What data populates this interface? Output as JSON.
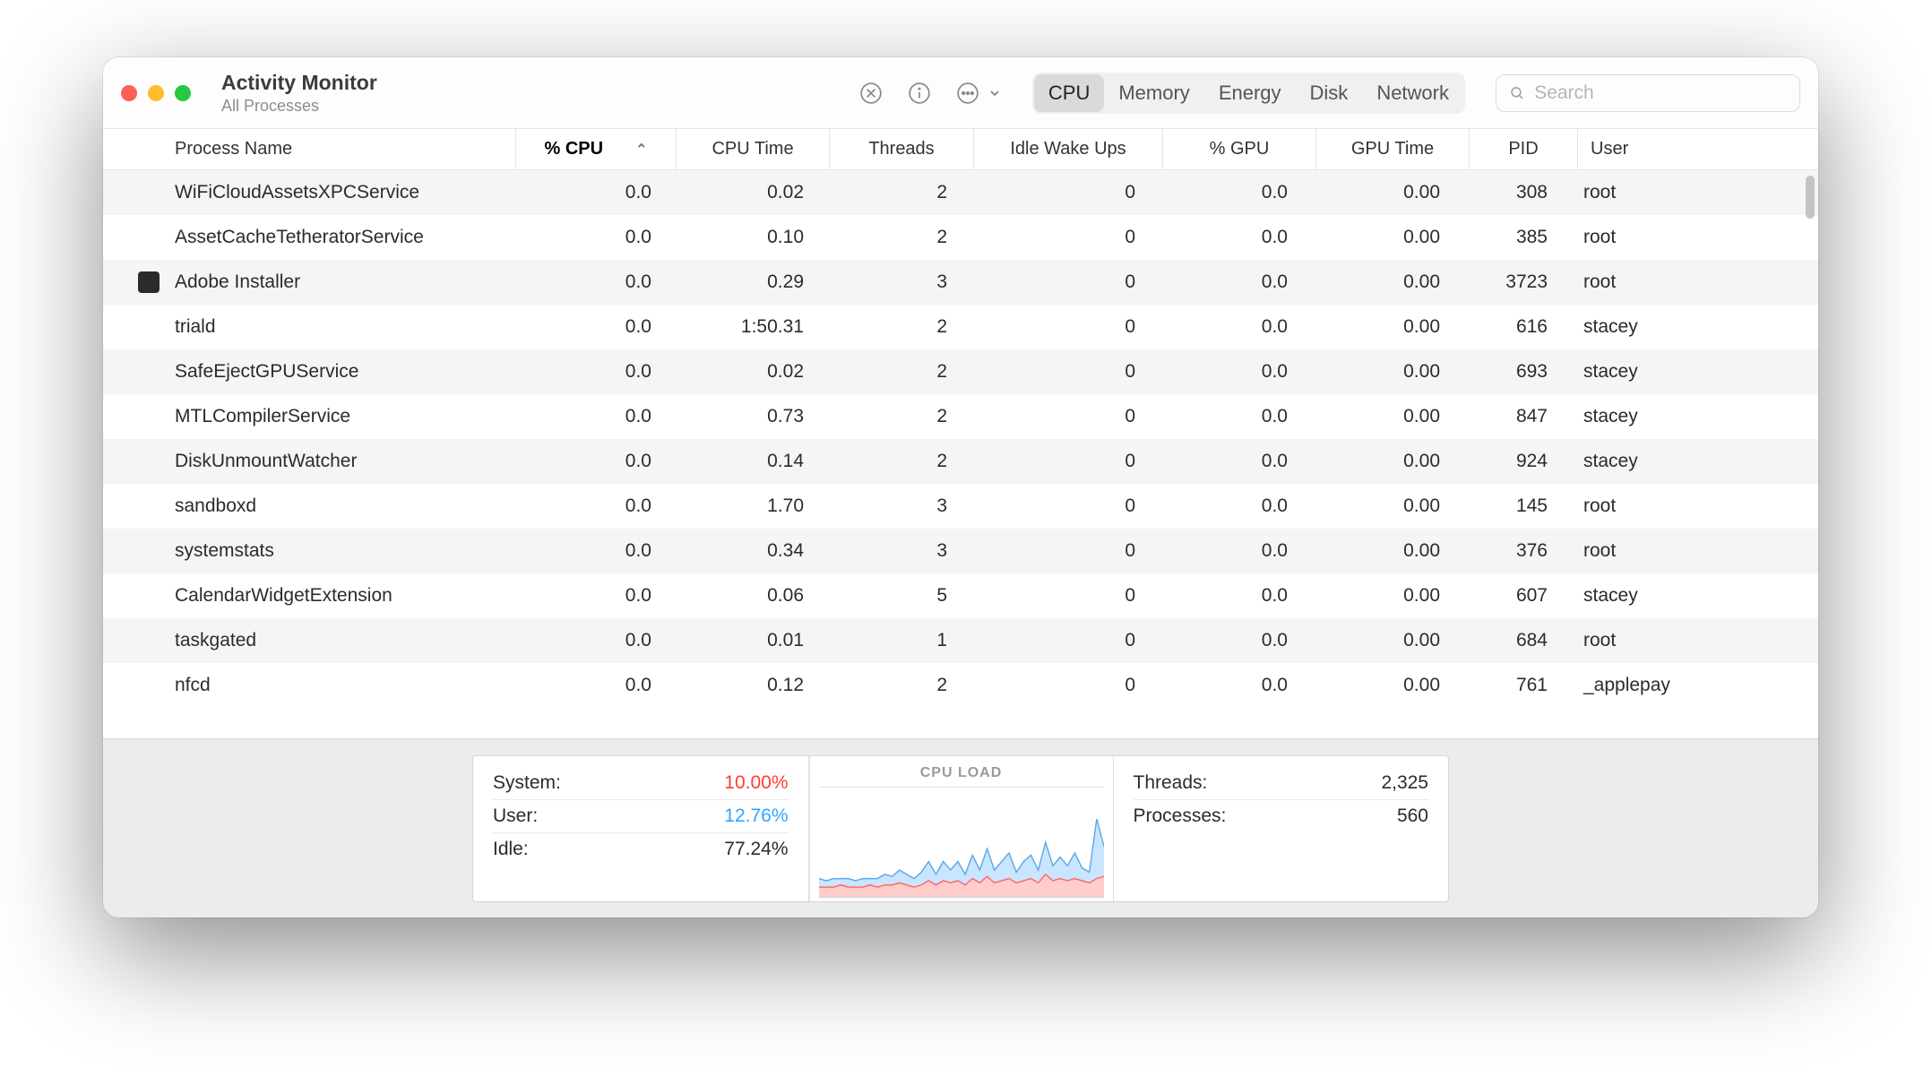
{
  "window": {
    "title": "Activity Monitor",
    "subtitle": "All Processes"
  },
  "toolbar": {
    "tabs": [
      "CPU",
      "Memory",
      "Energy",
      "Disk",
      "Network"
    ],
    "active_tab_index": 0,
    "search_placeholder": "Search"
  },
  "columns": {
    "headers": [
      "Process Name",
      "% CPU",
      "CPU Time",
      "Threads",
      "Idle Wake Ups",
      "% GPU",
      "GPU Time",
      "PID",
      "User"
    ],
    "sort_column_index": 1,
    "sort_direction": "asc"
  },
  "processes": [
    {
      "name": "WiFiCloudAssetsXPCService",
      "cpu": "0.0",
      "cpu_time": "0.02",
      "threads": "2",
      "idle_wake": "0",
      "gpu": "0.0",
      "gpu_time": "0.00",
      "pid": "308",
      "user": "root",
      "icon": null
    },
    {
      "name": "AssetCacheTetheratorService",
      "cpu": "0.0",
      "cpu_time": "0.10",
      "threads": "2",
      "idle_wake": "0",
      "gpu": "0.0",
      "gpu_time": "0.00",
      "pid": "385",
      "user": "root",
      "icon": null
    },
    {
      "name": "Adobe Installer",
      "cpu": "0.0",
      "cpu_time": "0.29",
      "threads": "3",
      "idle_wake": "0",
      "gpu": "0.0",
      "gpu_time": "0.00",
      "pid": "3723",
      "user": "root",
      "icon": "adobe"
    },
    {
      "name": "triald",
      "cpu": "0.0",
      "cpu_time": "1:50.31",
      "threads": "2",
      "idle_wake": "0",
      "gpu": "0.0",
      "gpu_time": "0.00",
      "pid": "616",
      "user": "stacey",
      "icon": null
    },
    {
      "name": "SafeEjectGPUService",
      "cpu": "0.0",
      "cpu_time": "0.02",
      "threads": "2",
      "idle_wake": "0",
      "gpu": "0.0",
      "gpu_time": "0.00",
      "pid": "693",
      "user": "stacey",
      "icon": null
    },
    {
      "name": "MTLCompilerService",
      "cpu": "0.0",
      "cpu_time": "0.73",
      "threads": "2",
      "idle_wake": "0",
      "gpu": "0.0",
      "gpu_time": "0.00",
      "pid": "847",
      "user": "stacey",
      "icon": null
    },
    {
      "name": "DiskUnmountWatcher",
      "cpu": "0.0",
      "cpu_time": "0.14",
      "threads": "2",
      "idle_wake": "0",
      "gpu": "0.0",
      "gpu_time": "0.00",
      "pid": "924",
      "user": "stacey",
      "icon": null
    },
    {
      "name": "sandboxd",
      "cpu": "0.0",
      "cpu_time": "1.70",
      "threads": "3",
      "idle_wake": "0",
      "gpu": "0.0",
      "gpu_time": "0.00",
      "pid": "145",
      "user": "root",
      "icon": null
    },
    {
      "name": "systemstats",
      "cpu": "0.0",
      "cpu_time": "0.34",
      "threads": "3",
      "idle_wake": "0",
      "gpu": "0.0",
      "gpu_time": "0.00",
      "pid": "376",
      "user": "root",
      "icon": null
    },
    {
      "name": "CalendarWidgetExtension",
      "cpu": "0.0",
      "cpu_time": "0.06",
      "threads": "5",
      "idle_wake": "0",
      "gpu": "0.0",
      "gpu_time": "0.00",
      "pid": "607",
      "user": "stacey",
      "icon": null
    },
    {
      "name": "taskgated",
      "cpu": "0.0",
      "cpu_time": "0.01",
      "threads": "1",
      "idle_wake": "0",
      "gpu": "0.0",
      "gpu_time": "0.00",
      "pid": "684",
      "user": "root",
      "icon": null
    },
    {
      "name": "nfcd",
      "cpu": "0.0",
      "cpu_time": "0.12",
      "threads": "2",
      "idle_wake": "0",
      "gpu": "0.0",
      "gpu_time": "0.00",
      "pid": "761",
      "user": "_applepay",
      "icon": null
    }
  ],
  "footer": {
    "system_label": "System:",
    "system_value": "10.00%",
    "user_label": "User:",
    "user_value": "12.76%",
    "idle_label": "Idle:",
    "idle_value": "77.24%",
    "load_title": "CPU LOAD",
    "threads_label": "Threads:",
    "threads_value": "2,325",
    "processes_label": "Processes:",
    "processes_value": "560"
  },
  "chart_data": {
    "type": "area",
    "title": "CPU LOAD",
    "xlabel": "",
    "ylabel": "",
    "ylim": [
      0,
      50
    ],
    "x": [
      0,
      1,
      2,
      3,
      4,
      5,
      6,
      7,
      8,
      9,
      10,
      11,
      12,
      13,
      14,
      15,
      16,
      17,
      18,
      19,
      20,
      21,
      22,
      23,
      24,
      25,
      26,
      27,
      28,
      29,
      30,
      31,
      32,
      33,
      34,
      35,
      36,
      37,
      38,
      39
    ],
    "series": [
      {
        "name": "System",
        "color": "#ff6b64",
        "values": [
          5,
          5,
          5,
          6,
          5,
          5,
          5,
          6,
          5,
          6,
          6,
          7,
          6,
          5,
          6,
          8,
          6,
          8,
          7,
          8,
          6,
          9,
          7,
          10,
          7,
          8,
          9,
          7,
          8,
          9,
          7,
          11,
          8,
          9,
          8,
          9,
          8,
          7,
          9,
          10
        ]
      },
      {
        "name": "User",
        "color": "#6cb8ff",
        "values": [
          4,
          3,
          4,
          3,
          4,
          3,
          4,
          3,
          4,
          5,
          4,
          6,
          5,
          4,
          6,
          9,
          5,
          9,
          6,
          9,
          5,
          11,
          6,
          13,
          6,
          9,
          12,
          5,
          9,
          11,
          6,
          15,
          7,
          10,
          7,
          12,
          6,
          5,
          28,
          14
        ]
      }
    ]
  }
}
